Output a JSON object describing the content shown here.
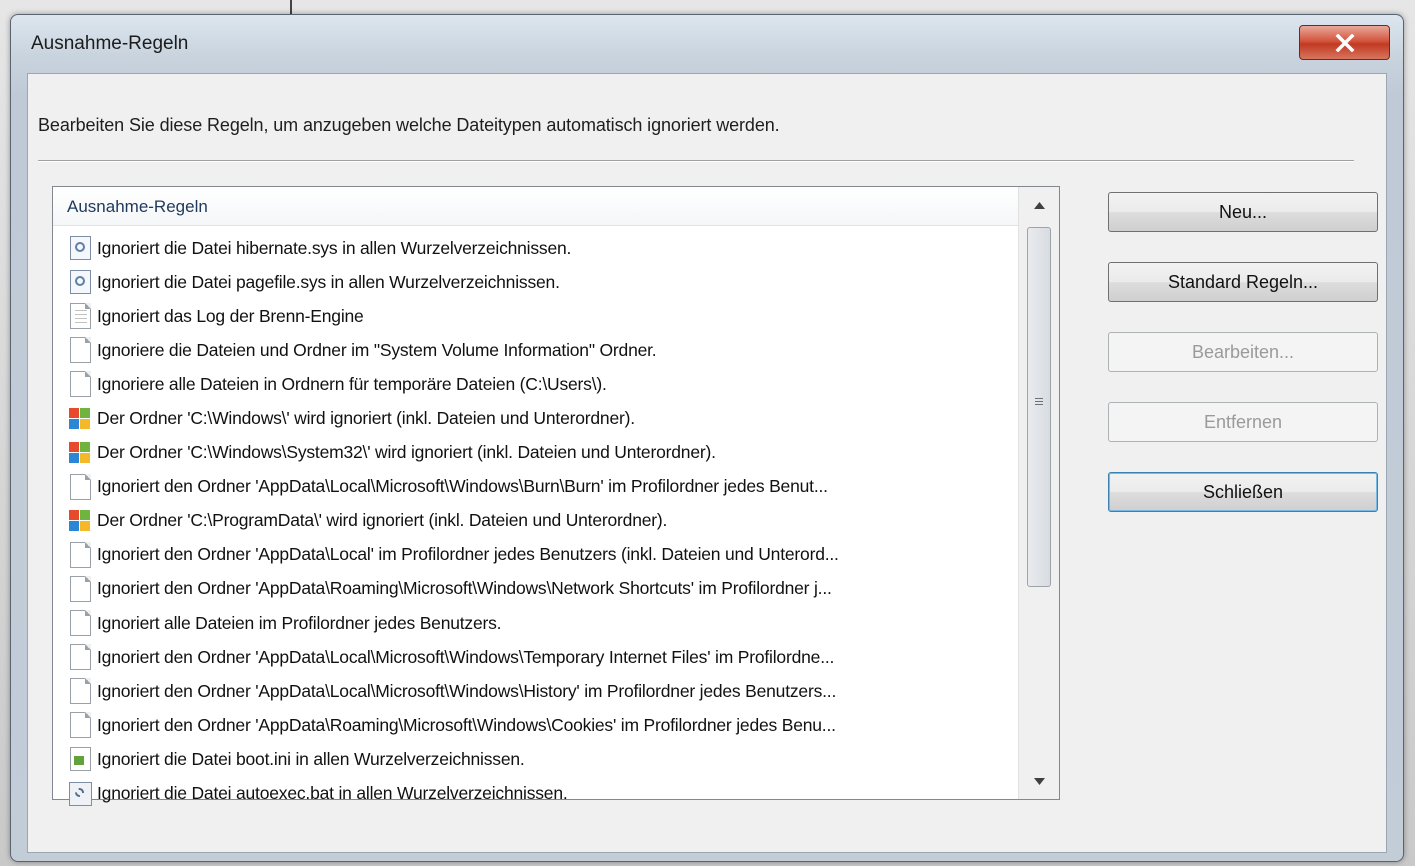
{
  "window": {
    "title": "Ausnahme-Regeln"
  },
  "description": "Bearbeiten Sie diese Regeln, um anzugeben welche Dateitypen automatisch ignoriert werden.",
  "list": {
    "header": "Ausnahme-Regeln",
    "items": [
      {
        "icon": "system-file-icon",
        "text": "Ignoriert die Datei hibernate.sys in allen Wurzelverzeichnissen."
      },
      {
        "icon": "system-file-icon",
        "text": "Ignoriert die Datei pagefile.sys in allen Wurzelverzeichnissen."
      },
      {
        "icon": "log-file-icon",
        "text": "Ignoriert das Log der Brenn-Engine"
      },
      {
        "icon": "file-icon",
        "text": "Ignoriere die Dateien und Ordner im \"System Volume Information\" Ordner."
      },
      {
        "icon": "file-icon",
        "text": "Ignoriere alle Dateien in Ordnern für temporäre Dateien (C:\\Users\\)."
      },
      {
        "icon": "windows-folder-icon",
        "text": "Der Ordner 'C:\\Windows\\' wird ignoriert (inkl. Dateien und Unterordner)."
      },
      {
        "icon": "windows-folder-icon",
        "text": "Der Ordner 'C:\\Windows\\System32\\' wird ignoriert (inkl. Dateien und Unterordner)."
      },
      {
        "icon": "file-icon",
        "text": "Ignoriert den Ordner 'AppData\\Local\\Microsoft\\Windows\\Burn\\Burn' im Profilordner jedes Benut..."
      },
      {
        "icon": "windows-folder-icon",
        "text": "Der Ordner 'C:\\ProgramData\\' wird ignoriert (inkl. Dateien und Unterordner)."
      },
      {
        "icon": "file-icon",
        "text": "Ignoriert den Ordner 'AppData\\Local' im Profilordner jedes Benutzers (inkl. Dateien und Unterord..."
      },
      {
        "icon": "file-icon",
        "text": "Ignoriert den Ordner 'AppData\\Roaming\\Microsoft\\Windows\\Network Shortcuts' im Profilordner j..."
      },
      {
        "icon": "file-icon",
        "text": "Ignoriert alle Dateien im Profilordner jedes Benutzers."
      },
      {
        "icon": "file-icon",
        "text": "Ignoriert den Ordner 'AppData\\Local\\Microsoft\\Windows\\Temporary Internet Files' im Profilordne..."
      },
      {
        "icon": "file-icon",
        "text": "Ignoriert den Ordner 'AppData\\Local\\Microsoft\\Windows\\History' im Profilordner jedes Benutzers..."
      },
      {
        "icon": "file-icon",
        "text": "Ignoriert den Ordner 'AppData\\Roaming\\Microsoft\\Windows\\Cookies' im Profilordner jedes Benu..."
      },
      {
        "icon": "ini-file-icon",
        "text": "Ignoriert die Datei boot.ini in allen Wurzelverzeichnissen."
      },
      {
        "icon": "batch-file-icon",
        "text": "Ignoriert die Datei autoexec.bat in allen Wurzelverzeichnissen."
      }
    ]
  },
  "buttons": {
    "new": "Neu...",
    "defaults": "Standard Regeln...",
    "edit": "Bearbeiten...",
    "remove": "Entfernen",
    "close": "Schließen"
  }
}
